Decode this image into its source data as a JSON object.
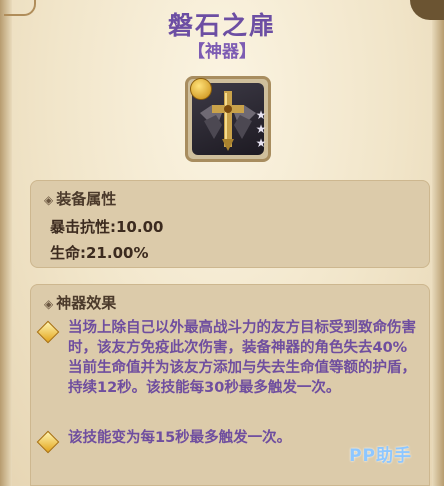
{
  "item": {
    "name": "磐石之扉",
    "category": "【神器】",
    "icon": "cross-shield-artifact-icon",
    "stars": 3
  },
  "attributes": {
    "header": "装备属性",
    "lines": [
      "暴击抗性:10.00",
      "生命:21.00%"
    ]
  },
  "effects": {
    "header": "神器效果",
    "items": [
      "当场上除自己以外最高战斗力的友方目标受到致命伤害时，该友方免疫此次伤害，装备神器的角色失去40%当前生命值并为该友方添加与失去生命值等额的护盾，持续12秒。该技能每30秒最多触发一次。",
      "该技能变为每15秒最多触发一次。"
    ]
  },
  "watermark": "PP助手",
  "colors": {
    "title": "#6c4ea3",
    "effect_text": "#6f4e9f",
    "panel": "#dccbaa"
  }
}
